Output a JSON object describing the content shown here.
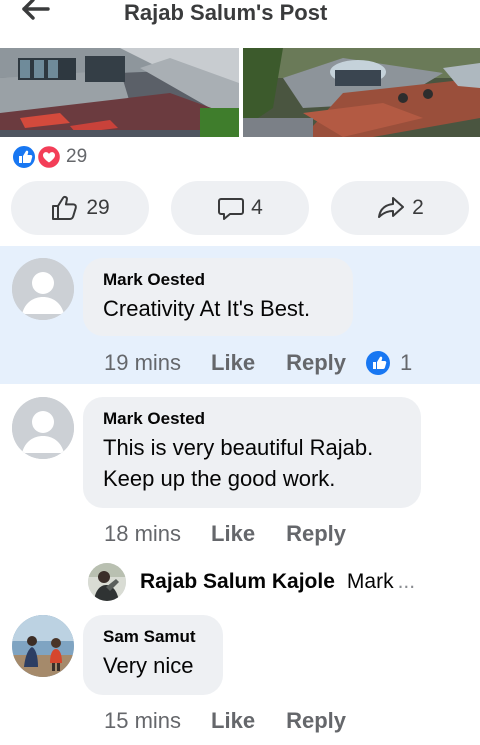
{
  "header": {
    "title": "Rajab Salum's Post",
    "back_icon": "back-arrow-icon"
  },
  "reactions": {
    "count": "29",
    "icons": [
      "like-reaction-icon",
      "love-reaction-icon"
    ]
  },
  "actions": {
    "like": {
      "icon": "thumbs-up-icon",
      "count": "29"
    },
    "comment": {
      "icon": "comment-icon",
      "count": "4"
    },
    "share": {
      "icon": "share-icon",
      "count": "2"
    }
  },
  "comments": [
    {
      "author": "Mark Oested",
      "lines": [
        "Creativity At It's Best."
      ],
      "time": "19 mins",
      "like_label": "Like",
      "reply_label": "Reply",
      "like_count": "1",
      "highlighted": true
    },
    {
      "author": "Mark Oested",
      "lines": [
        "This  is very beautiful Rajab.",
        "Keep up the good work."
      ],
      "time": "18 mins",
      "like_label": "Like",
      "reply_label": "Reply",
      "reply_preview": {
        "author": "Rajab Salum Kajole",
        "snippet": "Mark",
        "ellipsis": "..."
      }
    },
    {
      "author": "Sam Samut",
      "lines": [
        "Very nice"
      ],
      "time": "15 mins",
      "like_label": "Like",
      "reply_label": "Reply"
    }
  ],
  "colors": {
    "accent": "#1877f2",
    "love": "#f33e58",
    "highlight_bg": "#e6f0fc",
    "bubble_bg": "#eef0f3",
    "muted": "#65676b"
  }
}
